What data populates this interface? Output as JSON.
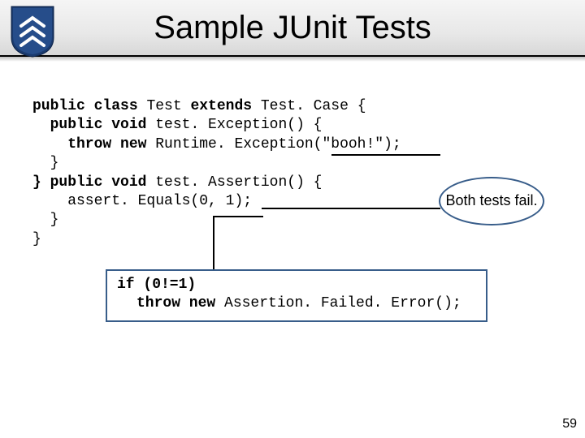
{
  "header": {
    "title": "Sample JUnit Tests"
  },
  "code": {
    "l1a": "public class ",
    "l1b": "Test ",
    "l1c": "extends ",
    "l1d": "Test. Case {",
    "l2a": "  public void ",
    "l2b": "test. Exception() {",
    "l3a": "    throw new ",
    "l3b": "Runtime. Exception(\"booh!\");",
    "l4": "  }",
    "l5a": "} public void ",
    "l5b": "test. Assertion() {",
    "l6": "    assert. Equals(0, 1);",
    "l7": "  }",
    "l8": "}"
  },
  "callout": {
    "text": "Both tests fail."
  },
  "explain": {
    "l1": "if (0!=1)",
    "l2": "throw new Assertion. Failed. Error();"
  },
  "page": "59"
}
